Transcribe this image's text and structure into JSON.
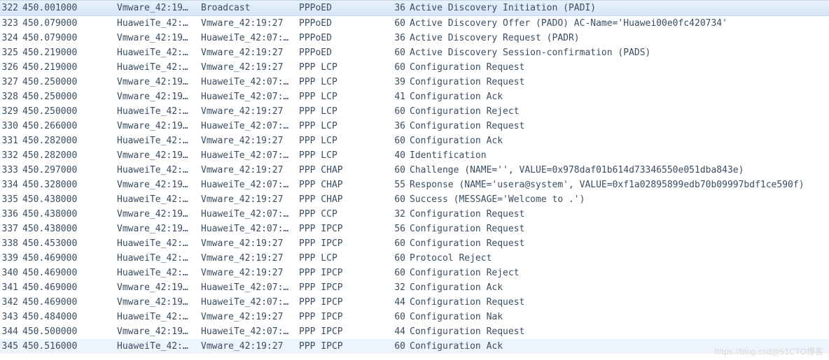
{
  "watermark": "https://blog.csd@51CTO博客",
  "packets": [
    {
      "no": "322",
      "time": "450.001000",
      "src": "Vmware_42:19…",
      "dst": "Broadcast",
      "proto": "PPPoED",
      "len": "36",
      "info": "Active Discovery Initiation (PADI)",
      "selected": true
    },
    {
      "no": "323",
      "time": "450.079000",
      "src": "HuaweiTe_42:…",
      "dst": "Vmware_42:19:27",
      "proto": "PPPoED",
      "len": "60",
      "info": "Active Discovery Offer (PADO) AC-Name='Huawei00e0fc420734'"
    },
    {
      "no": "324",
      "time": "450.079000",
      "src": "Vmware_42:19…",
      "dst": "HuaweiTe_42:07:…",
      "proto": "PPPoED",
      "len": "36",
      "info": "Active Discovery Request (PADR)"
    },
    {
      "no": "325",
      "time": "450.219000",
      "src": "HuaweiTe_42:…",
      "dst": "Vmware_42:19:27",
      "proto": "PPPoED",
      "len": "60",
      "info": "Active Discovery Session-confirmation (PADS)"
    },
    {
      "no": "326",
      "time": "450.219000",
      "src": "HuaweiTe_42:…",
      "dst": "Vmware_42:19:27",
      "proto": "PPP LCP",
      "len": "60",
      "info": "Configuration Request"
    },
    {
      "no": "327",
      "time": "450.250000",
      "src": "Vmware_42:19…",
      "dst": "HuaweiTe_42:07:…",
      "proto": "PPP LCP",
      "len": "39",
      "info": "Configuration Request"
    },
    {
      "no": "328",
      "time": "450.250000",
      "src": "Vmware_42:19…",
      "dst": "HuaweiTe_42:07:…",
      "proto": "PPP LCP",
      "len": "41",
      "info": "Configuration Ack"
    },
    {
      "no": "329",
      "time": "450.250000",
      "src": "HuaweiTe_42:…",
      "dst": "Vmware_42:19:27",
      "proto": "PPP LCP",
      "len": "60",
      "info": "Configuration Reject"
    },
    {
      "no": "330",
      "time": "450.266000",
      "src": "Vmware_42:19…",
      "dst": "HuaweiTe_42:07:…",
      "proto": "PPP LCP",
      "len": "36",
      "info": "Configuration Request"
    },
    {
      "no": "331",
      "time": "450.282000",
      "src": "HuaweiTe_42:…",
      "dst": "Vmware_42:19:27",
      "proto": "PPP LCP",
      "len": "60",
      "info": "Configuration Ack"
    },
    {
      "no": "332",
      "time": "450.282000",
      "src": "Vmware_42:19…",
      "dst": "HuaweiTe_42:07:…",
      "proto": "PPP LCP",
      "len": "40",
      "info": "Identification"
    },
    {
      "no": "333",
      "time": "450.297000",
      "src": "HuaweiTe_42:…",
      "dst": "Vmware_42:19:27",
      "proto": "PPP CHAP",
      "len": "60",
      "info": "Challenge (NAME='', VALUE=0x978daf01b614d73346550e051dba843e)"
    },
    {
      "no": "334",
      "time": "450.328000",
      "src": "Vmware_42:19…",
      "dst": "HuaweiTe_42:07:…",
      "proto": "PPP CHAP",
      "len": "55",
      "info": "Response (NAME='usera@system', VALUE=0xf1a02895899edb70b09997bdf1ce590f)"
    },
    {
      "no": "335",
      "time": "450.438000",
      "src": "HuaweiTe_42:…",
      "dst": "Vmware_42:19:27",
      "proto": "PPP CHAP",
      "len": "60",
      "info": "Success (MESSAGE='Welcome to .')"
    },
    {
      "no": "336",
      "time": "450.438000",
      "src": "Vmware_42:19…",
      "dst": "HuaweiTe_42:07:…",
      "proto": "PPP CCP",
      "len": "32",
      "info": "Configuration Request"
    },
    {
      "no": "337",
      "time": "450.438000",
      "src": "Vmware_42:19…",
      "dst": "HuaweiTe_42:07:…",
      "proto": "PPP IPCP",
      "len": "56",
      "info": "Configuration Request"
    },
    {
      "no": "338",
      "time": "450.453000",
      "src": "HuaweiTe_42:…",
      "dst": "Vmware_42:19:27",
      "proto": "PPP IPCP",
      "len": "60",
      "info": "Configuration Request"
    },
    {
      "no": "339",
      "time": "450.469000",
      "src": "HuaweiTe_42:…",
      "dst": "Vmware_42:19:27",
      "proto": "PPP LCP",
      "len": "60",
      "info": "Protocol Reject"
    },
    {
      "no": "340",
      "time": "450.469000",
      "src": "HuaweiTe_42:…",
      "dst": "Vmware_42:19:27",
      "proto": "PPP IPCP",
      "len": "60",
      "info": "Configuration Reject"
    },
    {
      "no": "341",
      "time": "450.469000",
      "src": "Vmware_42:19…",
      "dst": "HuaweiTe_42:07:…",
      "proto": "PPP IPCP",
      "len": "32",
      "info": "Configuration Ack"
    },
    {
      "no": "342",
      "time": "450.469000",
      "src": "Vmware_42:19…",
      "dst": "HuaweiTe_42:07:…",
      "proto": "PPP IPCP",
      "len": "44",
      "info": "Configuration Request"
    },
    {
      "no": "343",
      "time": "450.484000",
      "src": "HuaweiTe_42:…",
      "dst": "Vmware_42:19:27",
      "proto": "PPP IPCP",
      "len": "60",
      "info": "Configuration Nak"
    },
    {
      "no": "344",
      "time": "450.500000",
      "src": "Vmware_42:19…",
      "dst": "HuaweiTe_42:07:…",
      "proto": "PPP IPCP",
      "len": "44",
      "info": "Configuration Request"
    },
    {
      "no": "345",
      "time": "450.516000",
      "src": "HuaweiTe_42:…",
      "dst": "Vmware_42:19:27",
      "proto": "PPP IPCP",
      "len": "60",
      "info": "Configuration Ack",
      "lastrow": true
    }
  ]
}
